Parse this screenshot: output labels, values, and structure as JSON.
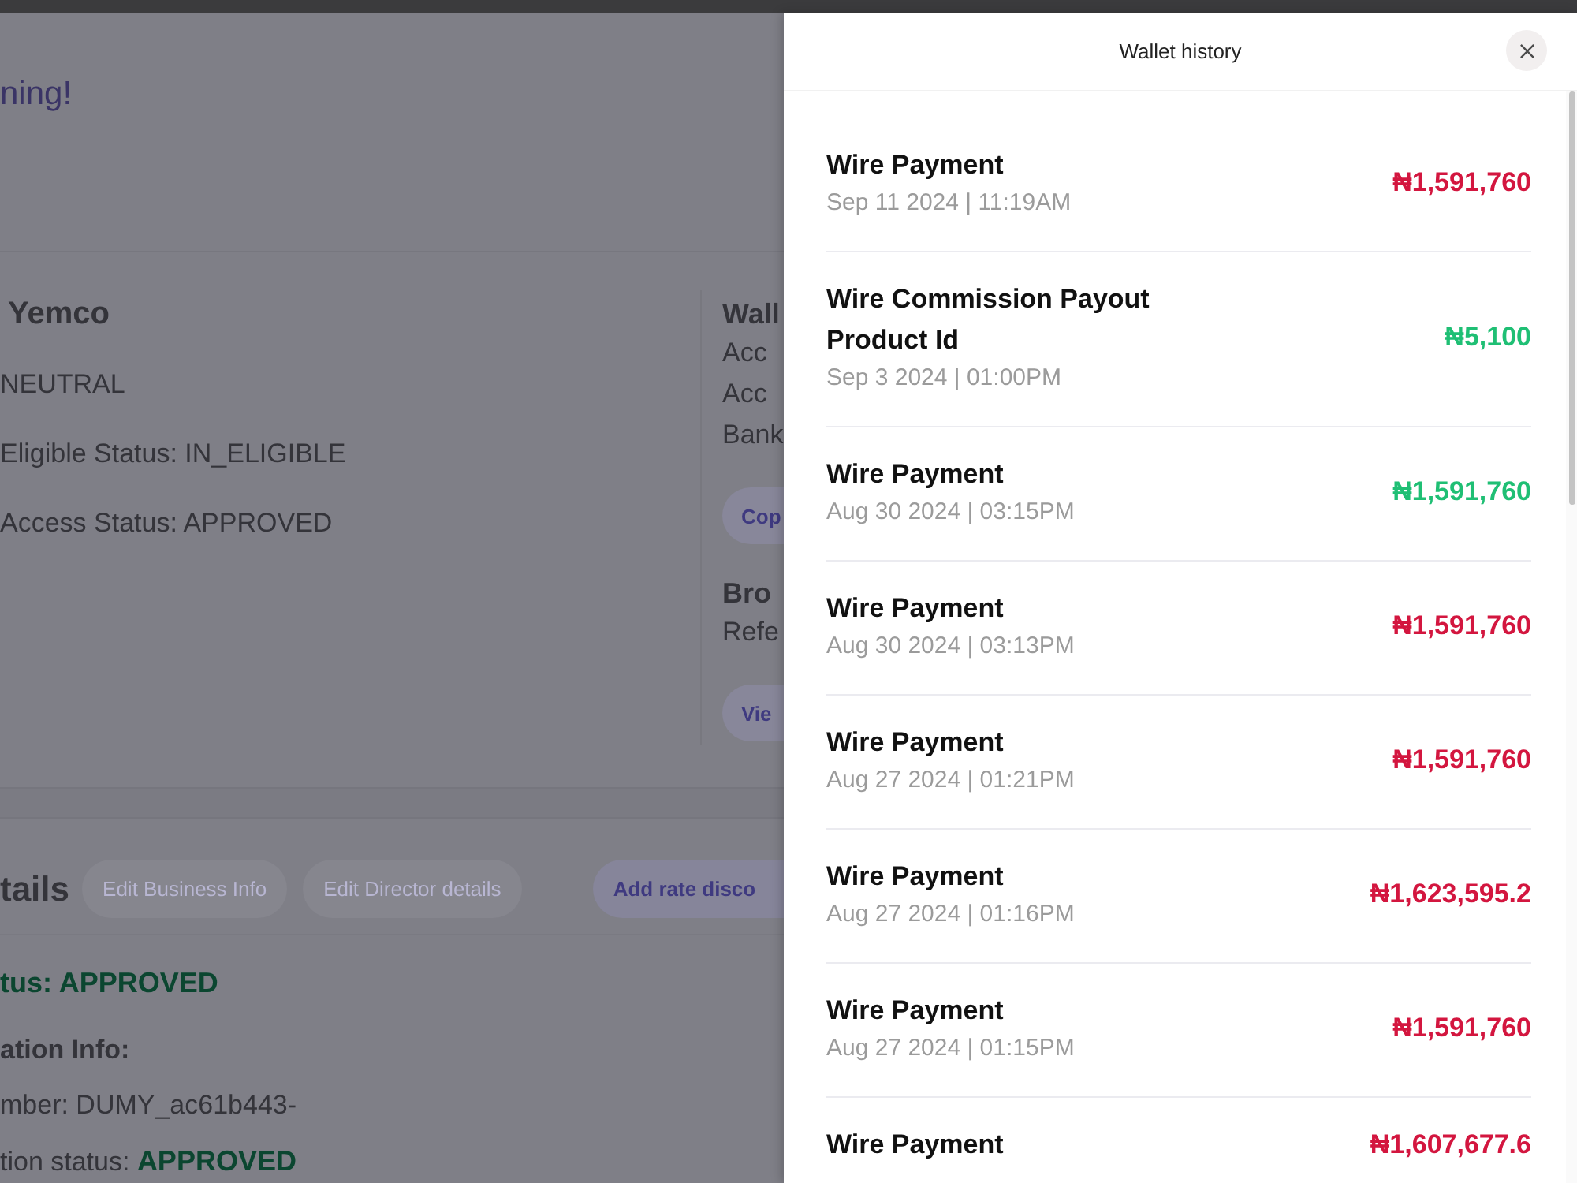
{
  "background_page": {
    "greeting": "ning!",
    "profile": {
      "name": "Yemco",
      "lines": [
        "NEUTRAL",
        "Eligible Status: IN_ELIGIBLE",
        "Access Status: APPROVED"
      ]
    },
    "wallet": {
      "title": "Wall",
      "lines": [
        "Acc",
        "Acc",
        "Bank"
      ],
      "button": "Cop"
    },
    "broker": {
      "title": "Bro",
      "lines": [
        "Refe"
      ],
      "button": "Vie"
    },
    "details": {
      "title": "tails",
      "buttons": [
        {
          "label": "Edit Business Info",
          "disabled": true
        },
        {
          "label": "Edit Director details",
          "disabled": true
        },
        {
          "label": "Add rate disco",
          "disabled": false
        }
      ],
      "lines": [
        {
          "kind": "status",
          "text": "tus: APPROVED"
        },
        {
          "kind": "heading",
          "text": "ation Info:"
        },
        {
          "kind": "field",
          "text": "mber: DUMY_ac61b443-"
        },
        {
          "kind": "status_field",
          "label": "tion status:",
          "value": "APPROVED"
        }
      ]
    }
  },
  "wallet_history": {
    "title": "Wallet history",
    "transactions": [
      {
        "title": "Wire Payment",
        "date": "Sep 11 2024 | 11:19AM",
        "amount": "₦1,591,760",
        "color": "#d3163f"
      },
      {
        "title": "Wire Commission Payout Product Id",
        "date": "Sep 3 2024 | 01:00PM",
        "amount": "₦5,100",
        "color": "#1fbf74"
      },
      {
        "title": "Wire Payment",
        "date": "Aug 30 2024 | 03:15PM",
        "amount": "₦1,591,760",
        "color": "#1fbf74"
      },
      {
        "title": "Wire Payment",
        "date": "Aug 30 2024 | 03:13PM",
        "amount": "₦1,591,760",
        "color": "#d3163f"
      },
      {
        "title": "Wire Payment",
        "date": "Aug 27 2024 | 01:21PM",
        "amount": "₦1,591,760",
        "color": "#d3163f"
      },
      {
        "title": "Wire Payment",
        "date": "Aug 27 2024 | 01:16PM",
        "amount": "₦1,623,595.2",
        "color": "#d3163f"
      },
      {
        "title": "Wire Payment",
        "date": "Aug 27 2024 | 01:15PM",
        "amount": "₦1,591,760",
        "color": "#d3163f"
      },
      {
        "title": "Wire Payment",
        "amount": "₦1,607,677.6",
        "color": "#d3163f"
      }
    ]
  }
}
